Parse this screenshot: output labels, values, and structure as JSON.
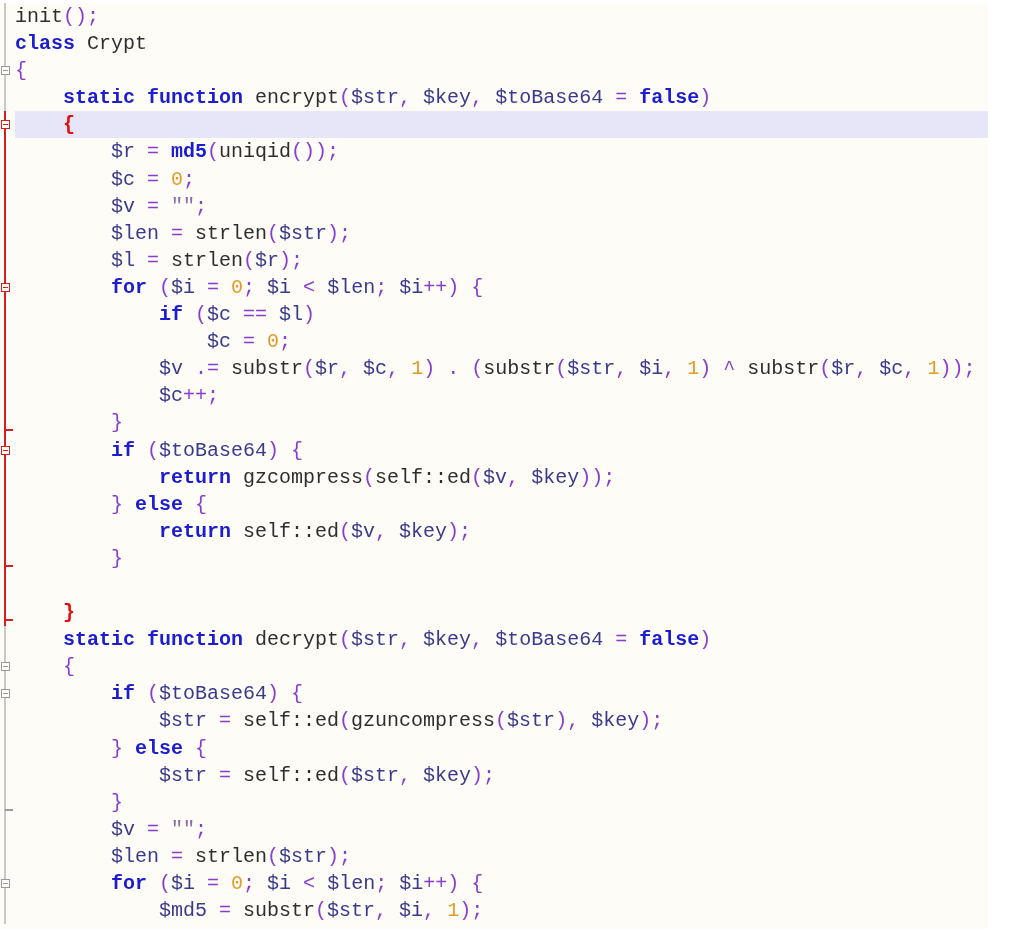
{
  "editor": {
    "lines": [
      {
        "fold_start": false,
        "fold_end": false,
        "active": false,
        "current": false,
        "tokens": [
          {
            "kind": "plain",
            "text": "init"
          },
          {
            "kind": "op",
            "text": "();"
          }
        ]
      },
      {
        "fold_start": false,
        "fold_end": false,
        "active": false,
        "current": false,
        "tokens": [
          {
            "kind": "kw",
            "text": "class"
          },
          {
            "kind": "plain",
            "text": " Crypt"
          }
        ]
      },
      {
        "fold_start": true,
        "fold_end": false,
        "active": false,
        "current": false,
        "tokens": [
          {
            "kind": "op",
            "text": "{"
          }
        ],
        "children": [
          {
            "fold_start": false,
            "fold_end": false,
            "active": false,
            "current": false,
            "tokens": [
              {
                "kind": "kw",
                "text": "static function"
              },
              {
                "kind": "plain",
                "text": " encrypt"
              },
              {
                "kind": "op",
                "text": "("
              },
              {
                "kind": "var",
                "text": "$str"
              },
              {
                "kind": "op",
                "text": ", "
              },
              {
                "kind": "var",
                "text": "$key"
              },
              {
                "kind": "op",
                "text": ", "
              },
              {
                "kind": "var",
                "text": "$toBase64"
              },
              {
                "kind": "op",
                "text": " = "
              },
              {
                "kind": "kw",
                "text": "false"
              },
              {
                "kind": "op",
                "text": ")"
              }
            ]
          },
          {
            "fold_start": true,
            "fold_end": false,
            "active": true,
            "current": true,
            "tokens": [
              {
                "kind": "match",
                "text": "{"
              }
            ],
            "children": [
              {
                "fold_start": false,
                "fold_end": false,
                "active": true,
                "current": false,
                "tokens": [
                  {
                    "kind": "var",
                    "text": "$r"
                  },
                  {
                    "kind": "op",
                    "text": " = "
                  },
                  {
                    "kind": "kw",
                    "text": "md5"
                  },
                  {
                    "kind": "op",
                    "text": "("
                  },
                  {
                    "kind": "plain",
                    "text": "uniqid"
                  },
                  {
                    "kind": "op",
                    "text": "());"
                  }
                ]
              },
              {
                "fold_start": false,
                "fold_end": false,
                "active": true,
                "current": false,
                "tokens": [
                  {
                    "kind": "var",
                    "text": "$c"
                  },
                  {
                    "kind": "op",
                    "text": " = "
                  },
                  {
                    "kind": "num",
                    "text": "0"
                  },
                  {
                    "kind": "op",
                    "text": ";"
                  }
                ]
              },
              {
                "fold_start": false,
                "fold_end": false,
                "active": true,
                "current": false,
                "tokens": [
                  {
                    "kind": "var",
                    "text": "$v"
                  },
                  {
                    "kind": "op",
                    "text": " = "
                  },
                  {
                    "kind": "str",
                    "text": "\"\""
                  },
                  {
                    "kind": "op",
                    "text": ";"
                  }
                ]
              },
              {
                "fold_start": false,
                "fold_end": false,
                "active": true,
                "current": false,
                "tokens": [
                  {
                    "kind": "var",
                    "text": "$len"
                  },
                  {
                    "kind": "op",
                    "text": " = "
                  },
                  {
                    "kind": "plain",
                    "text": "strlen"
                  },
                  {
                    "kind": "op",
                    "text": "("
                  },
                  {
                    "kind": "var",
                    "text": "$str"
                  },
                  {
                    "kind": "op",
                    "text": ");"
                  }
                ]
              },
              {
                "fold_start": false,
                "fold_end": false,
                "active": true,
                "current": false,
                "tokens": [
                  {
                    "kind": "var",
                    "text": "$l"
                  },
                  {
                    "kind": "op",
                    "text": " = "
                  },
                  {
                    "kind": "plain",
                    "text": "strlen"
                  },
                  {
                    "kind": "op",
                    "text": "("
                  },
                  {
                    "kind": "var",
                    "text": "$r"
                  },
                  {
                    "kind": "op",
                    "text": ");"
                  }
                ]
              },
              {
                "fold_start": true,
                "fold_end": false,
                "active": true,
                "current": false,
                "tokens": [
                  {
                    "kind": "kw",
                    "text": "for"
                  },
                  {
                    "kind": "op",
                    "text": " ("
                  },
                  {
                    "kind": "var",
                    "text": "$i"
                  },
                  {
                    "kind": "op",
                    "text": " = "
                  },
                  {
                    "kind": "num",
                    "text": "0"
                  },
                  {
                    "kind": "op",
                    "text": "; "
                  },
                  {
                    "kind": "var",
                    "text": "$i"
                  },
                  {
                    "kind": "op",
                    "text": " < "
                  },
                  {
                    "kind": "var",
                    "text": "$len"
                  },
                  {
                    "kind": "op",
                    "text": "; "
                  },
                  {
                    "kind": "var",
                    "text": "$i"
                  },
                  {
                    "kind": "op",
                    "text": "++) {"
                  }
                ],
                "children": [
                  {
                    "fold_start": false,
                    "fold_end": false,
                    "active": true,
                    "current": false,
                    "tokens": [
                      {
                        "kind": "kw",
                        "text": "if"
                      },
                      {
                        "kind": "op",
                        "text": " ("
                      },
                      {
                        "kind": "var",
                        "text": "$c"
                      },
                      {
                        "kind": "op",
                        "text": " == "
                      },
                      {
                        "kind": "var",
                        "text": "$l"
                      },
                      {
                        "kind": "op",
                        "text": ")"
                      }
                    ],
                    "children": [
                      {
                        "fold_start": false,
                        "fold_end": false,
                        "active": true,
                        "current": false,
                        "tokens": [
                          {
                            "kind": "var",
                            "text": "$c"
                          },
                          {
                            "kind": "op",
                            "text": " = "
                          },
                          {
                            "kind": "num",
                            "text": "0"
                          },
                          {
                            "kind": "op",
                            "text": ";"
                          }
                        ]
                      }
                    ]
                  },
                  {
                    "fold_start": false,
                    "fold_end": false,
                    "active": true,
                    "current": false,
                    "tokens": [
                      {
                        "kind": "var",
                        "text": "$v"
                      },
                      {
                        "kind": "op",
                        "text": " .= "
                      },
                      {
                        "kind": "plain",
                        "text": "substr"
                      },
                      {
                        "kind": "op",
                        "text": "("
                      },
                      {
                        "kind": "var",
                        "text": "$r"
                      },
                      {
                        "kind": "op",
                        "text": ", "
                      },
                      {
                        "kind": "var",
                        "text": "$c"
                      },
                      {
                        "kind": "op",
                        "text": ", "
                      },
                      {
                        "kind": "num",
                        "text": "1"
                      },
                      {
                        "kind": "op",
                        "text": ") . ("
                      },
                      {
                        "kind": "plain",
                        "text": "substr"
                      },
                      {
                        "kind": "op",
                        "text": "("
                      },
                      {
                        "kind": "var",
                        "text": "$str"
                      },
                      {
                        "kind": "op",
                        "text": ", "
                      },
                      {
                        "kind": "var",
                        "text": "$i"
                      },
                      {
                        "kind": "op",
                        "text": ", "
                      },
                      {
                        "kind": "num",
                        "text": "1"
                      },
                      {
                        "kind": "op",
                        "text": ") ^ "
                      },
                      {
                        "kind": "plain",
                        "text": "substr"
                      },
                      {
                        "kind": "op",
                        "text": "("
                      },
                      {
                        "kind": "var",
                        "text": "$r"
                      },
                      {
                        "kind": "op",
                        "text": ", "
                      },
                      {
                        "kind": "var",
                        "text": "$c"
                      },
                      {
                        "kind": "op",
                        "text": ", "
                      },
                      {
                        "kind": "num",
                        "text": "1"
                      },
                      {
                        "kind": "op",
                        "text": "));"
                      }
                    ]
                  },
                  {
                    "fold_start": false,
                    "fold_end": false,
                    "active": true,
                    "current": false,
                    "tokens": [
                      {
                        "kind": "var",
                        "text": "$c"
                      },
                      {
                        "kind": "op",
                        "text": "++;"
                      }
                    ]
                  }
                ]
              },
              {
                "fold_start": false,
                "fold_end": true,
                "active": true,
                "current": false,
                "tokens": [
                  {
                    "kind": "op",
                    "text": "}"
                  }
                ]
              },
              {
                "fold_start": true,
                "fold_end": false,
                "active": true,
                "current": false,
                "tokens": [
                  {
                    "kind": "kw",
                    "text": "if"
                  },
                  {
                    "kind": "op",
                    "text": " ("
                  },
                  {
                    "kind": "var",
                    "text": "$toBase64"
                  },
                  {
                    "kind": "op",
                    "text": ") {"
                  }
                ],
                "children": [
                  {
                    "fold_start": false,
                    "fold_end": false,
                    "active": true,
                    "current": false,
                    "tokens": [
                      {
                        "kind": "kw",
                        "text": "return"
                      },
                      {
                        "kind": "plain",
                        "text": " gzcompress"
                      },
                      {
                        "kind": "op",
                        "text": "("
                      },
                      {
                        "kind": "plain",
                        "text": "self::ed"
                      },
                      {
                        "kind": "op",
                        "text": "("
                      },
                      {
                        "kind": "var",
                        "text": "$v"
                      },
                      {
                        "kind": "op",
                        "text": ", "
                      },
                      {
                        "kind": "var",
                        "text": "$key"
                      },
                      {
                        "kind": "op",
                        "text": "));"
                      }
                    ]
                  }
                ]
              },
              {
                "fold_start": false,
                "fold_end": false,
                "active": true,
                "current": false,
                "tokens": [
                  {
                    "kind": "op",
                    "text": "} "
                  },
                  {
                    "kind": "kw",
                    "text": "else"
                  },
                  {
                    "kind": "op",
                    "text": " {"
                  }
                ],
                "children": [
                  {
                    "fold_start": false,
                    "fold_end": false,
                    "active": true,
                    "current": false,
                    "tokens": [
                      {
                        "kind": "kw",
                        "text": "return"
                      },
                      {
                        "kind": "plain",
                        "text": " self::ed"
                      },
                      {
                        "kind": "op",
                        "text": "("
                      },
                      {
                        "kind": "var",
                        "text": "$v"
                      },
                      {
                        "kind": "op",
                        "text": ", "
                      },
                      {
                        "kind": "var",
                        "text": "$key"
                      },
                      {
                        "kind": "op",
                        "text": ");"
                      }
                    ]
                  }
                ]
              },
              {
                "fold_start": false,
                "fold_end": true,
                "active": true,
                "current": false,
                "tokens": [
                  {
                    "kind": "op",
                    "text": "}"
                  }
                ]
              },
              {
                "fold_start": false,
                "fold_end": false,
                "active": true,
                "current": false
              }
            ]
          },
          {
            "fold_start": false,
            "fold_end": true,
            "active": true,
            "current": false,
            "tokens": [
              {
                "kind": "match",
                "text": "}"
              }
            ]
          },
          {
            "fold_start": false,
            "fold_end": false,
            "active": false,
            "current": false,
            "tokens": [
              {
                "kind": "kw",
                "text": "static function"
              },
              {
                "kind": "plain",
                "text": " decrypt"
              },
              {
                "kind": "op",
                "text": "("
              },
              {
                "kind": "var",
                "text": "$str"
              },
              {
                "kind": "op",
                "text": ", "
              },
              {
                "kind": "var",
                "text": "$key"
              },
              {
                "kind": "op",
                "text": ", "
              },
              {
                "kind": "var",
                "text": "$toBase64"
              },
              {
                "kind": "op",
                "text": " = "
              },
              {
                "kind": "kw",
                "text": "false"
              },
              {
                "kind": "op",
                "text": ")"
              }
            ]
          },
          {
            "fold_start": true,
            "fold_end": false,
            "active": false,
            "current": false,
            "tokens": [
              {
                "kind": "op",
                "text": "{"
              }
            ],
            "children": [
              {
                "fold_start": true,
                "fold_end": false,
                "active": false,
                "current": false,
                "tokens": [
                  {
                    "kind": "kw",
                    "text": "if"
                  },
                  {
                    "kind": "op",
                    "text": " ("
                  },
                  {
                    "kind": "var",
                    "text": "$toBase64"
                  },
                  {
                    "kind": "op",
                    "text": ") {"
                  }
                ],
                "children": [
                  {
                    "fold_start": false,
                    "fold_end": false,
                    "active": false,
                    "current": false,
                    "tokens": [
                      {
                        "kind": "var",
                        "text": "$str"
                      },
                      {
                        "kind": "op",
                        "text": " = "
                      },
                      {
                        "kind": "plain",
                        "text": "self::ed"
                      },
                      {
                        "kind": "op",
                        "text": "("
                      },
                      {
                        "kind": "plain",
                        "text": "gzuncompress"
                      },
                      {
                        "kind": "op",
                        "text": "("
                      },
                      {
                        "kind": "var",
                        "text": "$str"
                      },
                      {
                        "kind": "op",
                        "text": "), "
                      },
                      {
                        "kind": "var",
                        "text": "$key"
                      },
                      {
                        "kind": "op",
                        "text": ");"
                      }
                    ]
                  }
                ]
              },
              {
                "fold_start": false,
                "fold_end": false,
                "active": false,
                "current": false,
                "tokens": [
                  {
                    "kind": "op",
                    "text": "} "
                  },
                  {
                    "kind": "kw",
                    "text": "else"
                  },
                  {
                    "kind": "op",
                    "text": " {"
                  }
                ],
                "children": [
                  {
                    "fold_start": false,
                    "fold_end": false,
                    "active": false,
                    "current": false,
                    "tokens": [
                      {
                        "kind": "var",
                        "text": "$str"
                      },
                      {
                        "kind": "op",
                        "text": " = "
                      },
                      {
                        "kind": "plain",
                        "text": "self::ed"
                      },
                      {
                        "kind": "op",
                        "text": "("
                      },
                      {
                        "kind": "var",
                        "text": "$str"
                      },
                      {
                        "kind": "op",
                        "text": ", "
                      },
                      {
                        "kind": "var",
                        "text": "$key"
                      },
                      {
                        "kind": "op",
                        "text": ");"
                      }
                    ]
                  }
                ]
              },
              {
                "fold_start": false,
                "fold_end": true,
                "active": false,
                "current": false,
                "tokens": [
                  {
                    "kind": "op",
                    "text": "}"
                  }
                ]
              },
              {
                "fold_start": false,
                "fold_end": false,
                "active": false,
                "current": false,
                "tokens": [
                  {
                    "kind": "var",
                    "text": "$v"
                  },
                  {
                    "kind": "op",
                    "text": " = "
                  },
                  {
                    "kind": "str",
                    "text": "\"\""
                  },
                  {
                    "kind": "op",
                    "text": ";"
                  }
                ]
              },
              {
                "fold_start": false,
                "fold_end": false,
                "active": false,
                "current": false,
                "tokens": [
                  {
                    "kind": "var",
                    "text": "$len"
                  },
                  {
                    "kind": "op",
                    "text": " = "
                  },
                  {
                    "kind": "plain",
                    "text": "strlen"
                  },
                  {
                    "kind": "op",
                    "text": "("
                  },
                  {
                    "kind": "var",
                    "text": "$str"
                  },
                  {
                    "kind": "op",
                    "text": ");"
                  }
                ]
              },
              {
                "fold_start": true,
                "fold_end": false,
                "active": false,
                "current": false,
                "tokens": [
                  {
                    "kind": "kw",
                    "text": "for"
                  },
                  {
                    "kind": "op",
                    "text": " ("
                  },
                  {
                    "kind": "var",
                    "text": "$i"
                  },
                  {
                    "kind": "op",
                    "text": " = "
                  },
                  {
                    "kind": "num",
                    "text": "0"
                  },
                  {
                    "kind": "op",
                    "text": "; "
                  },
                  {
                    "kind": "var",
                    "text": "$i"
                  },
                  {
                    "kind": "op",
                    "text": " < "
                  },
                  {
                    "kind": "var",
                    "text": "$len"
                  },
                  {
                    "kind": "op",
                    "text": "; "
                  },
                  {
                    "kind": "var",
                    "text": "$i"
                  },
                  {
                    "kind": "op",
                    "text": "++) {"
                  }
                ],
                "children": [
                  {
                    "fold_start": false,
                    "fold_end": false,
                    "active": false,
                    "current": false,
                    "tokens": [
                      {
                        "kind": "var",
                        "text": "$md5"
                      },
                      {
                        "kind": "op",
                        "text": " = "
                      },
                      {
                        "kind": "plain",
                        "text": "substr"
                      },
                      {
                        "kind": "op",
                        "text": "("
                      },
                      {
                        "kind": "var",
                        "text": "$str"
                      },
                      {
                        "kind": "op",
                        "text": ", "
                      },
                      {
                        "kind": "var",
                        "text": "$i"
                      },
                      {
                        "kind": "op",
                        "text": ", "
                      },
                      {
                        "kind": "num",
                        "text": "1"
                      },
                      {
                        "kind": "op",
                        "text": ");"
                      }
                    ]
                  }
                ]
              }
            ]
          }
        ]
      }
    ]
  }
}
